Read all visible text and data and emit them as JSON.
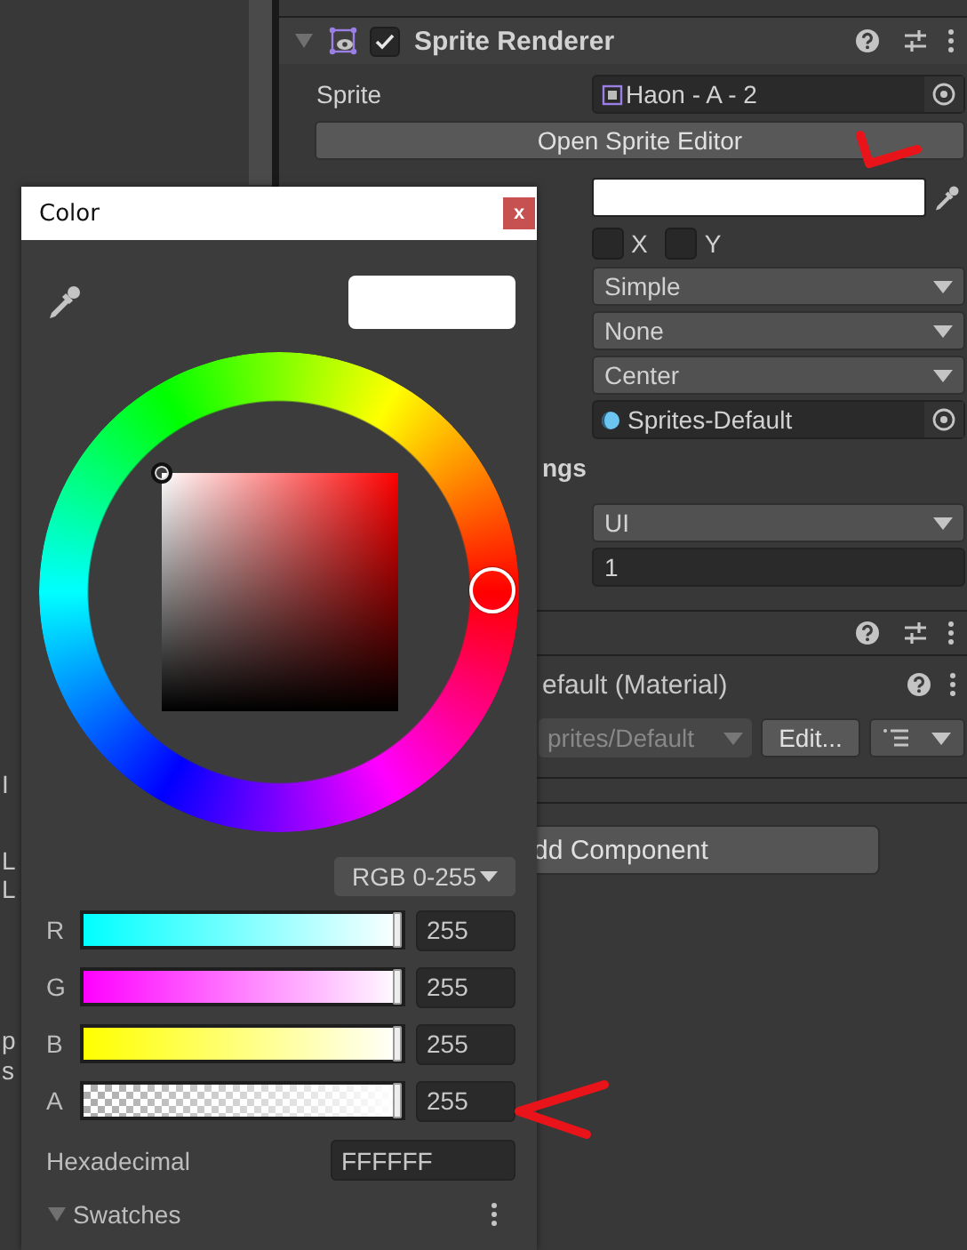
{
  "left_panel_fragments": [
    "I",
    "L",
    "L",
    "p",
    "s"
  ],
  "inspector": {
    "component": {
      "title": "Sprite Renderer",
      "enabled": true,
      "expanded": true
    },
    "sprite": {
      "label": "Sprite",
      "value": "Haon - A - 2"
    },
    "open_editor_button": "Open Sprite Editor",
    "flip": [
      {
        "label": "X",
        "checked": false
      },
      {
        "label": "Y",
        "checked": false
      }
    ],
    "dropdowns": [
      "Simple",
      "None",
      "Center"
    ],
    "material": "Sprites-Default",
    "section_fragment": "ngs",
    "sorting_layer": "UI",
    "order": "1",
    "material_header": "efault (Material)",
    "shader": "prites/Default",
    "edit_button": "Edit...",
    "add_component": "dd Component"
  },
  "color_window": {
    "title": "Color",
    "close": "x",
    "mode": "RGB 0-255",
    "sliders": [
      {
        "kind": "red",
        "label": "R",
        "level": 1,
        "value": "255"
      },
      {
        "kind": "green",
        "label": "G",
        "level": 1,
        "value": "255"
      },
      {
        "kind": "blue",
        "label": "B",
        "level": 1,
        "value": "255"
      },
      {
        "kind": "alpha",
        "label": "A",
        "level": 1,
        "value": "255"
      }
    ],
    "hex_label": "Hexadecimal",
    "hex": "FFFFFF",
    "swatches": {
      "label": "Swatches",
      "expanded": true
    }
  }
}
